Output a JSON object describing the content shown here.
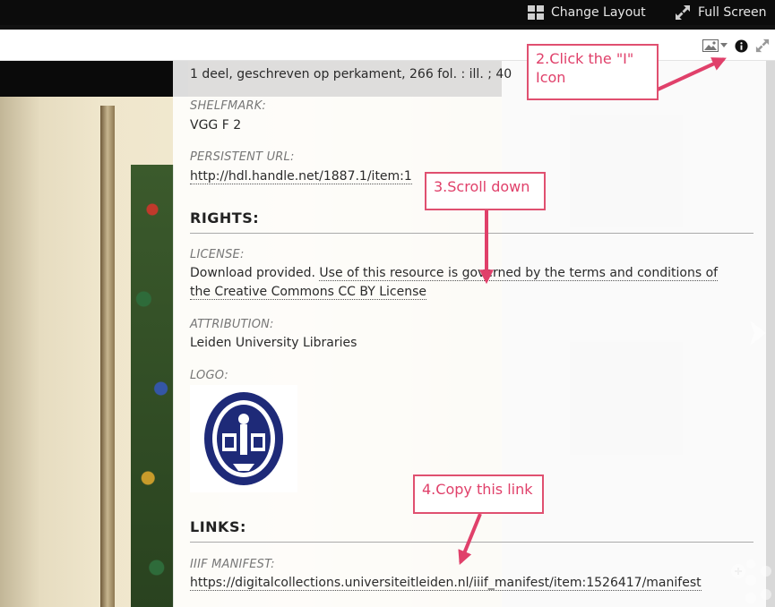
{
  "topbar": {
    "change_layout_label": "Change Layout",
    "full_screen_label": "Full Screen"
  },
  "toolbar": {
    "icons": [
      "image-icon",
      "chevron-down-icon",
      "info-icon",
      "expand-icon"
    ]
  },
  "metadata": {
    "physical_description": "1 deel, geschreven op perkament, 266 fol. : ill. ; 40",
    "shelfmark_label": "SHELFMARK:",
    "shelfmark_value": "VGG F 2",
    "persistent_url_label": "PERSISTENT URL:",
    "persistent_url_value": "http://hdl.handle.net/1887.1/item:1"
  },
  "rights": {
    "heading": "RIGHTS:",
    "license_label": "LICENSE:",
    "license_prefix": "Download provided. ",
    "license_link_line1": "Use of this resource is governed by the terms and conditions of",
    "license_link_line2": "the Creative Commons CC BY License",
    "attribution_label": "ATTRIBUTION:",
    "attribution_value": "Leiden University Libraries",
    "logo_label": "LOGO:"
  },
  "links": {
    "heading": "LINKS:",
    "iiif_label": "IIIF MANIFEST:",
    "iiif_value": "https://digitalcollections.universiteitleiden.nl/iiif_manifest/item:1526417/manifest"
  },
  "annotations": {
    "step2": "2.Click the \"I\" Icon",
    "step3": "3.Scroll down",
    "step4": "4.Copy this link"
  },
  "colors": {
    "annotation": "#e0406a",
    "topbar": "#0c0c0c",
    "panel": "#ffffff"
  }
}
